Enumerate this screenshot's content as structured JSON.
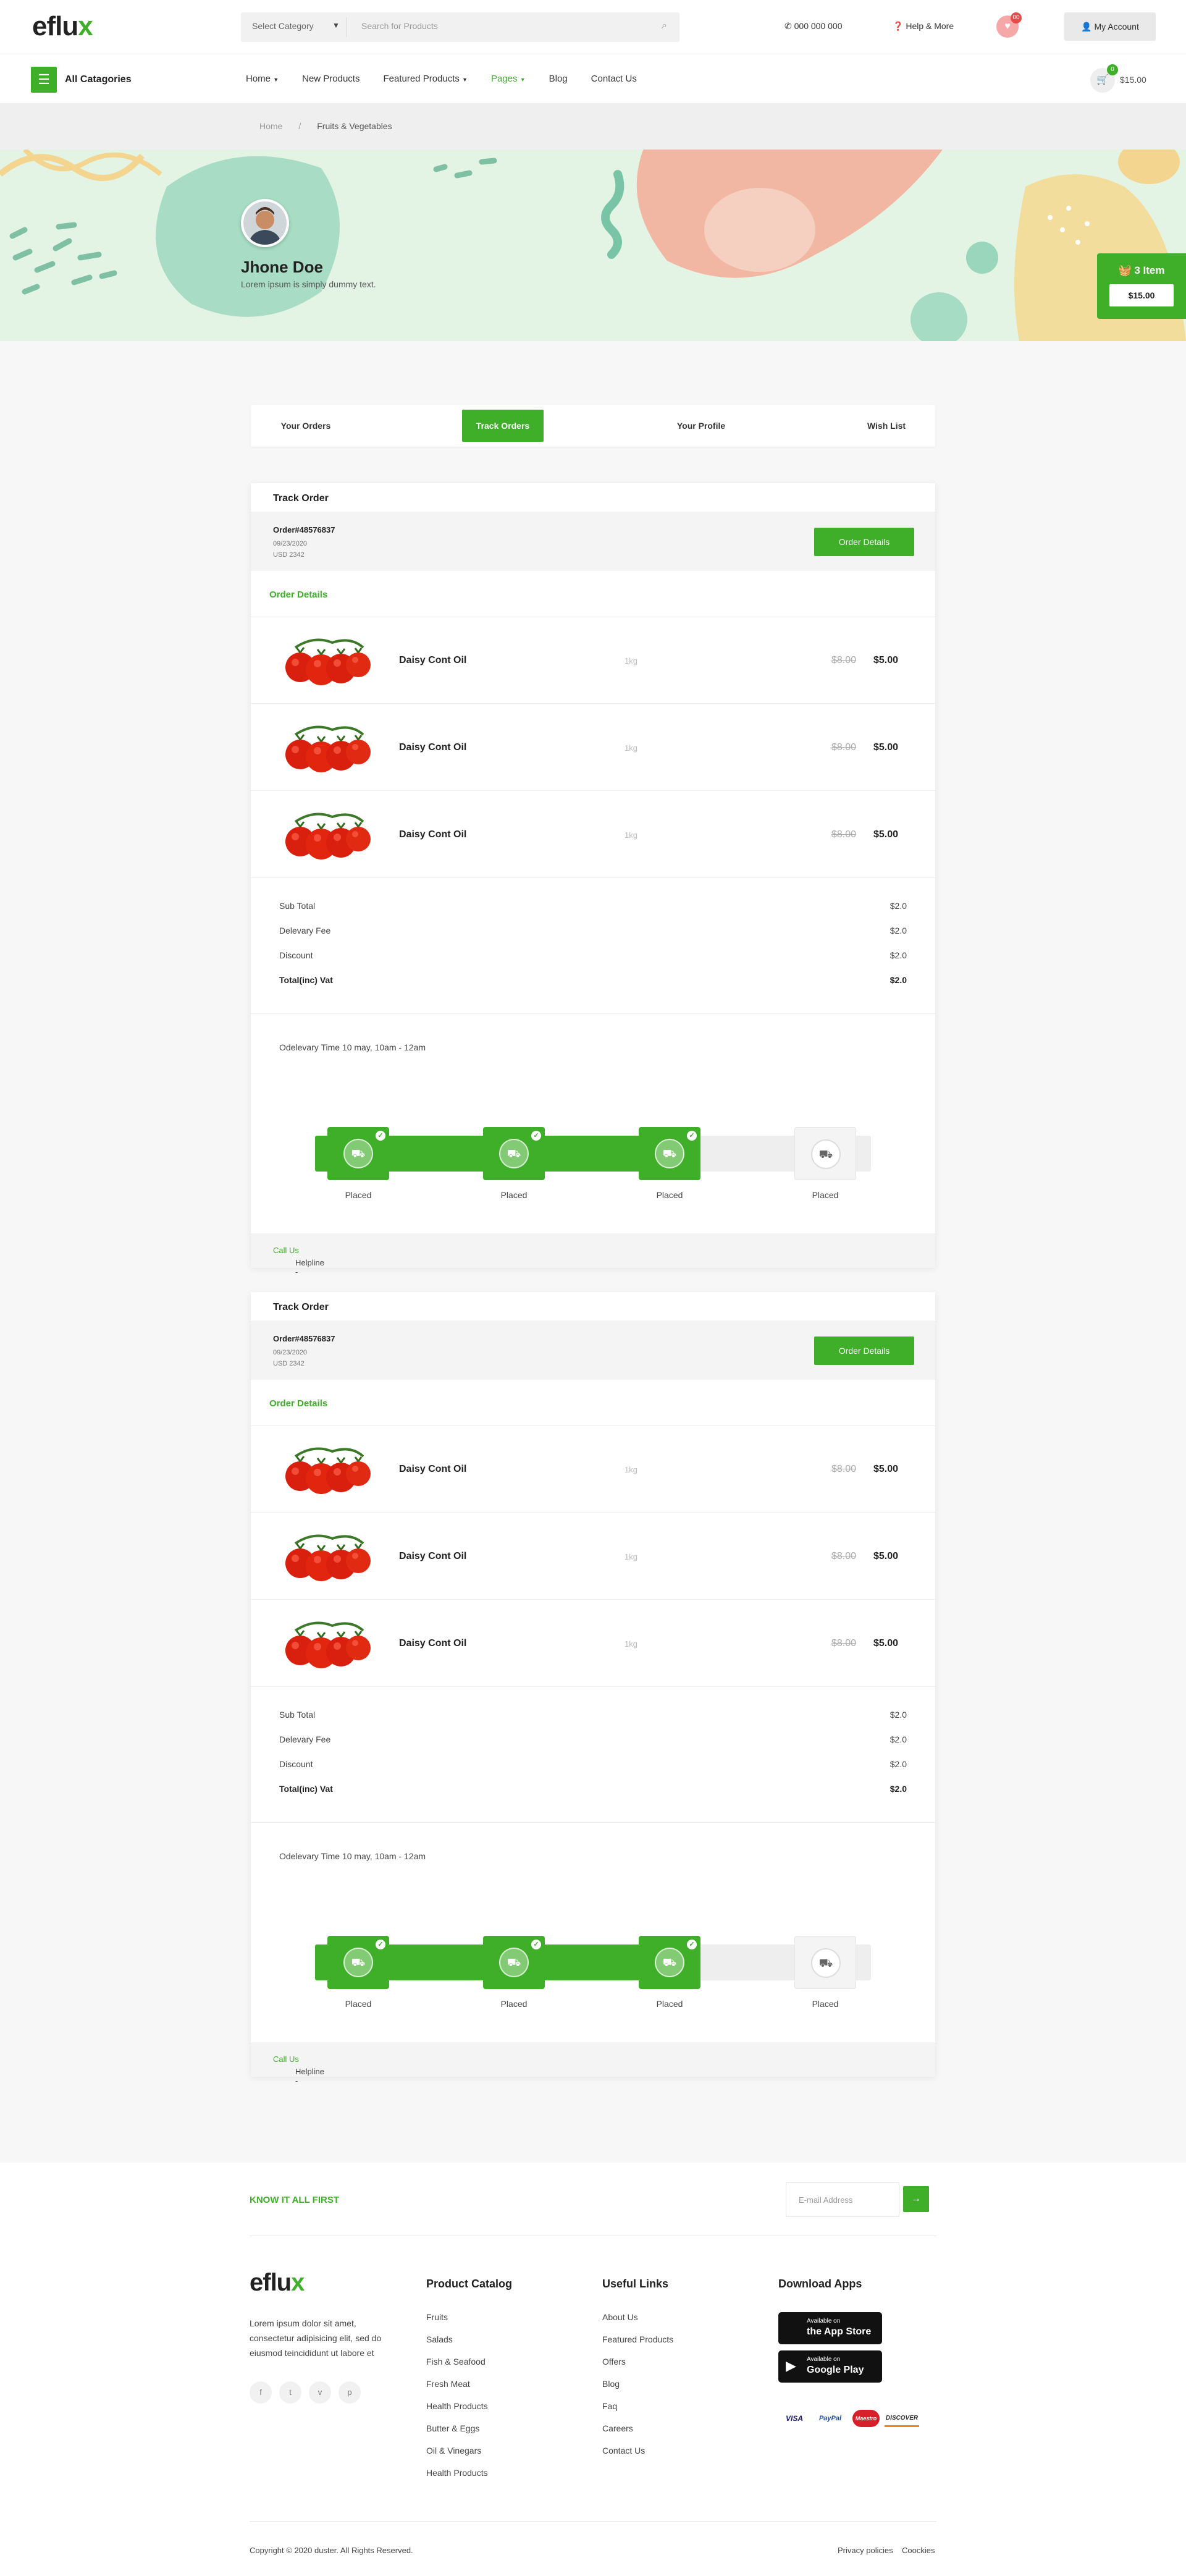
{
  "header": {
    "logo_text": "eflu",
    "logo_accent": "x",
    "category_select": "Select Category",
    "search_placeholder": "Search for Products",
    "phone": "000 000 000",
    "help": "Help & More",
    "wishlist_count": "00",
    "account": "My Account"
  },
  "nav": {
    "all_categories": "All Catagories",
    "menu": [
      "Home",
      "New Products",
      "Featured Products",
      "Pages",
      "Blog",
      "Contact Us"
    ],
    "cart_count": "0",
    "cart_total": "$15.00"
  },
  "breadcrumb": {
    "home": "Home",
    "sep": "/",
    "current": "Fruits & Vegetables"
  },
  "profile": {
    "name": "Jhone Doe",
    "bio": "Lorem ipsum is simply dummy text."
  },
  "mini_cart": {
    "items": "3 Item",
    "price": "$15.00"
  },
  "tabs": [
    "Your Orders",
    "Track Orders",
    "Your Profile",
    "Wish List"
  ],
  "orders": [
    {
      "title": "Track Order",
      "order_id": "Order#48576837",
      "date": "09/23/2020",
      "amount": "USD 2342",
      "details_button": "Order Details",
      "details_label": "Order Details",
      "products": [
        {
          "name": "Daisy Cont Oil",
          "weight": "1kg",
          "old_price": "$8.00",
          "price": "$5.00"
        },
        {
          "name": "Daisy Cont Oil",
          "weight": "1kg",
          "old_price": "$8.00",
          "price": "$5.00"
        },
        {
          "name": "Daisy Cont Oil",
          "weight": "1kg",
          "old_price": "$8.00",
          "price": "$5.00"
        }
      ],
      "summary": [
        {
          "label": "Sub Total",
          "value": "$2.0"
        },
        {
          "label": "Delevary Fee",
          "value": "$2.0"
        },
        {
          "label": "Discount",
          "value": "$2.0"
        },
        {
          "label": "Total(inc) Vat",
          "value": "$2.0"
        }
      ],
      "delivery_time": "Odelevary Time 10 may, 10am - 12am",
      "steps": [
        {
          "label": "Placed",
          "done": true
        },
        {
          "label": "Placed",
          "done": true
        },
        {
          "label": "Placed",
          "done": true
        },
        {
          "label": "Placed",
          "done": false
        }
      ],
      "helpline": "Helpline -",
      "call_us": "Call Us"
    },
    {
      "title": "Track Order",
      "order_id": "Order#48576837",
      "date": "09/23/2020",
      "amount": "USD 2342",
      "details_button": "Order Details",
      "details_label": "Order Details",
      "products": [
        {
          "name": "Daisy Cont Oil",
          "weight": "1kg",
          "old_price": "$8.00",
          "price": "$5.00"
        },
        {
          "name": "Daisy Cont Oil",
          "weight": "1kg",
          "old_price": "$8.00",
          "price": "$5.00"
        },
        {
          "name": "Daisy Cont Oil",
          "weight": "1kg",
          "old_price": "$8.00",
          "price": "$5.00"
        }
      ],
      "summary": [
        {
          "label": "Sub Total",
          "value": "$2.0"
        },
        {
          "label": "Delevary Fee",
          "value": "$2.0"
        },
        {
          "label": "Discount",
          "value": "$2.0"
        },
        {
          "label": "Total(inc) Vat",
          "value": "$2.0"
        }
      ],
      "delivery_time": "Odelevary Time 10 may, 10am - 12am",
      "steps": [
        {
          "label": "Placed",
          "done": true
        },
        {
          "label": "Placed",
          "done": true
        },
        {
          "label": "Placed",
          "done": true
        },
        {
          "label": "Placed",
          "done": false
        }
      ],
      "helpline": "Helpline -",
      "call_us": "Call Us"
    }
  ],
  "footer": {
    "know_first": "KNOW IT ALL FIRST",
    "email_placeholder": "E-mail Address",
    "description": "Lorem ipsum dolor sit amet, consectetur adipisicing elit, sed do eiusmod teincididunt ut labore et",
    "social": [
      "f",
      "t",
      "v",
      "p"
    ],
    "catalog_title": "Product Catalog",
    "catalog": [
      "Fruits",
      "Salads",
      "Fish & Seafood",
      "Fresh Meat",
      "Health Products",
      "Butter & Eggs",
      "Oil & Vinegars",
      "Health Products"
    ],
    "links_title": "Useful Links",
    "links": [
      "About Us",
      "Featured Products",
      "Offers",
      "Blog",
      "Faq",
      "Careers",
      "Contact Us"
    ],
    "apps_title": "Download Apps",
    "app_store": {
      "small": "Available on",
      "big": "the App Store"
    },
    "google_play": {
      "small": "Available on",
      "big": "Google Play"
    },
    "payments": [
      "VISA",
      "PayPal",
      "Maestro",
      "DISCOVER"
    ],
    "copyright": "Copyright © 2020 duster. All Rights Reserved.",
    "legal": [
      "Privacy policies",
      "Coockies"
    ]
  },
  "colors": {
    "accent": "#3fae29",
    "hero_bg": "#e4f4e4"
  }
}
